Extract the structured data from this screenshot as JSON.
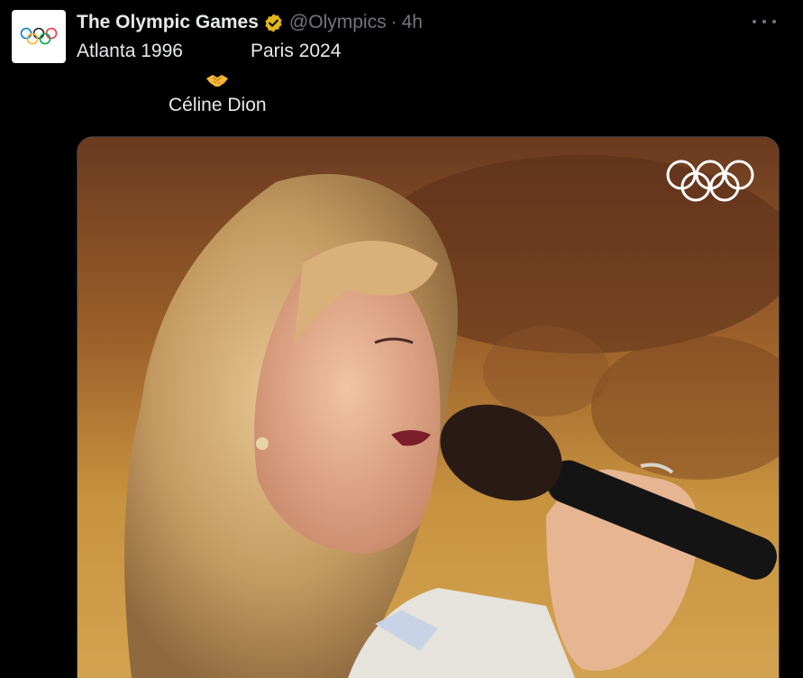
{
  "post": {
    "author_name": "The Olympic Games",
    "handle": "@Olympics",
    "separator": "·",
    "time": "4h",
    "line1_left": "Atlanta 1996",
    "line1_right": "Paris 2024",
    "line2": "Céline Dion"
  },
  "icons": {
    "avatar": "olympic-rings-icon",
    "verified": "verified-badge-gold-icon",
    "more": "more-options-icon",
    "emoji": "handshake-emoji-icon",
    "media_watermark": "olympic-rings-watermark-icon"
  },
  "colors": {
    "background": "#000000",
    "text_primary": "#e7e9ea",
    "text_secondary": "#71767b",
    "verified_gold": "#e2b719"
  }
}
